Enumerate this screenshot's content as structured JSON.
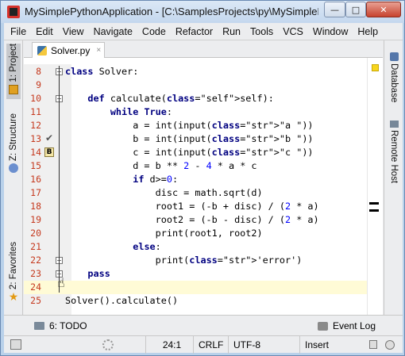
{
  "window": {
    "title": "MySimplePythonApplication - [C:\\SamplesProjects\\py\\MySimplePyt...",
    "min_glyph": "—",
    "max_glyph": "□",
    "close_glyph": "✕"
  },
  "menu": [
    "File",
    "Edit",
    "View",
    "Navigate",
    "Code",
    "Refactor",
    "Run",
    "Tools",
    "VCS",
    "Window",
    "Help"
  ],
  "left_tools": {
    "project": "1: Project",
    "structure": "Z: Structure",
    "favorites": "2: Favorites"
  },
  "right_tools": {
    "database": "Database",
    "remote_host": "Remote Host"
  },
  "editor": {
    "tab_label": "Solver.py",
    "tab_close": "×",
    "lines": [
      {
        "n": "8",
        "code": "class Solver:"
      },
      {
        "n": "9",
        "code": ""
      },
      {
        "n": "10",
        "code": "    def calculate(self):"
      },
      {
        "n": "11",
        "code": "        while True:"
      },
      {
        "n": "12",
        "code": "            a = int(input(\"a \"))"
      },
      {
        "n": "13",
        "code": "            b = int(input(\"b \"))"
      },
      {
        "n": "14",
        "code": "            c = int(input(\"c \"))"
      },
      {
        "n": "15",
        "code": "            d = b ** 2 - 4 * a * c"
      },
      {
        "n": "16",
        "code": "            if d>=0:"
      },
      {
        "n": "17",
        "code": "                disc = math.sqrt(d)"
      },
      {
        "n": "18",
        "code": "                root1 = (-b + disc) / (2 * a)"
      },
      {
        "n": "19",
        "code": "                root2 = (-b - disc) / (2 * a)"
      },
      {
        "n": "20",
        "code": "                print(root1, root2)"
      },
      {
        "n": "21",
        "code": "            else:"
      },
      {
        "n": "22",
        "code": "                print('error')"
      },
      {
        "n": "23",
        "code": "    pass"
      },
      {
        "n": "24",
        "code": ""
      },
      {
        "n": "25",
        "code": "Solver().calculate()"
      }
    ],
    "bookmark_letter": "B",
    "current_line": "24"
  },
  "bottom_tools": {
    "todo": "6: TODO",
    "event_log": "Event Log"
  },
  "status": {
    "position": "24:1",
    "line_sep": "CRLF",
    "encoding": "UTF-8",
    "mode": "Insert"
  }
}
